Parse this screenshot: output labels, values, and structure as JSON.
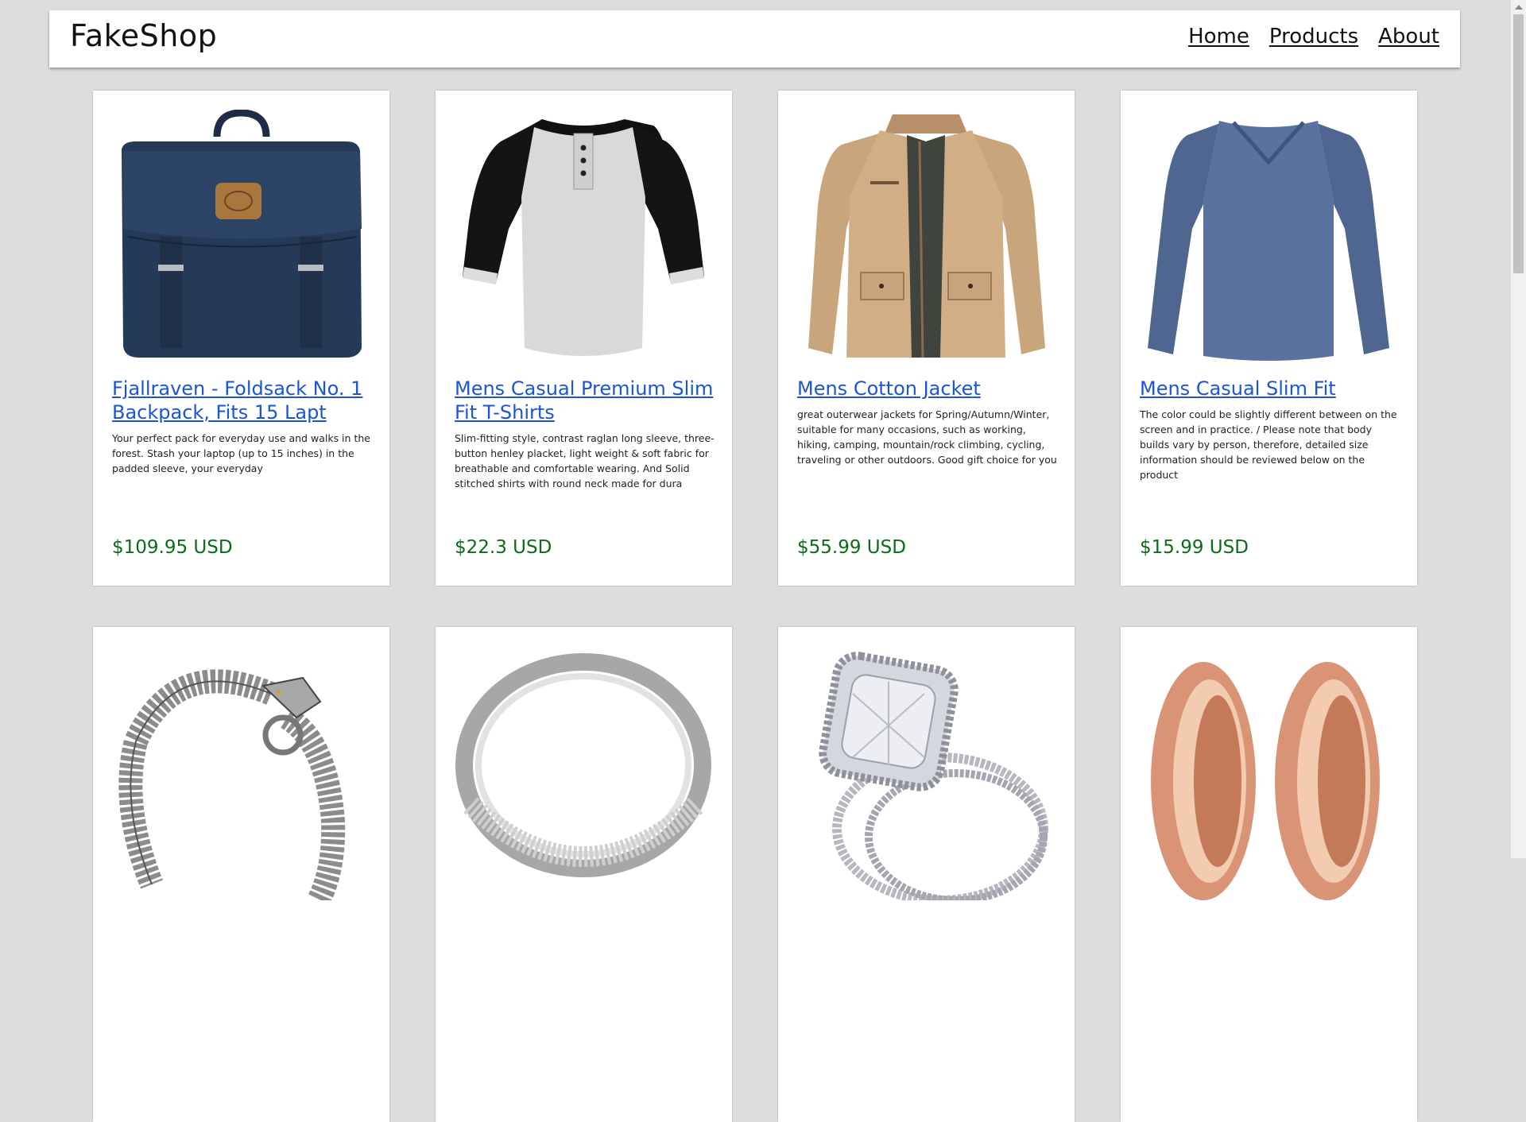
{
  "header": {
    "brand": "FakeShop",
    "nav": [
      "Home",
      "Products",
      "About"
    ]
  },
  "products": [
    {
      "title": "Fjallraven - Foldsack No. 1 Backpack, Fits 15 Lapt",
      "description": "Your perfect pack for everyday use and walks in the forest. Stash your laptop (up to 15 inches) in the padded sleeve, your everyday",
      "price": "$109.95 USD",
      "image": "navy-backpack"
    },
    {
      "title": "Mens Casual Premium Slim Fit T-Shirts",
      "description": "Slim-fitting style, contrast raglan long sleeve, three-button henley placket, light weight & soft fabric for breathable and comfortable wearing. And Solid stitched shirts with round neck made for dura",
      "price": "$22.3 USD",
      "image": "raglan-henley-shirt"
    },
    {
      "title": "Mens Cotton Jacket",
      "description": "great outerwear jackets for Spring/Autumn/Winter, suitable for many occasions, such as working, hiking, camping, mountain/rock climbing, cycling, traveling or other outdoors. Good gift choice for you",
      "price": "$55.99 USD",
      "image": "khaki-jacket"
    },
    {
      "title": "Mens Casual Slim Fit",
      "description": "The color could be slightly different between on the screen and in practice. / Please note that body builds vary by person, therefore, detailed size information should be reviewed below on the product",
      "price": "$15.99 USD",
      "image": "blue-long-sleeve-shirt"
    },
    {
      "image": "dragon-chain-bracelet"
    },
    {
      "image": "silver-band-ring"
    },
    {
      "image": "diamond-ring-set"
    },
    {
      "image": "rose-gold-plugs"
    }
  ],
  "colors": {
    "link": "#1a55d6",
    "price": "#0b6b18",
    "background": "#dcdedd"
  }
}
